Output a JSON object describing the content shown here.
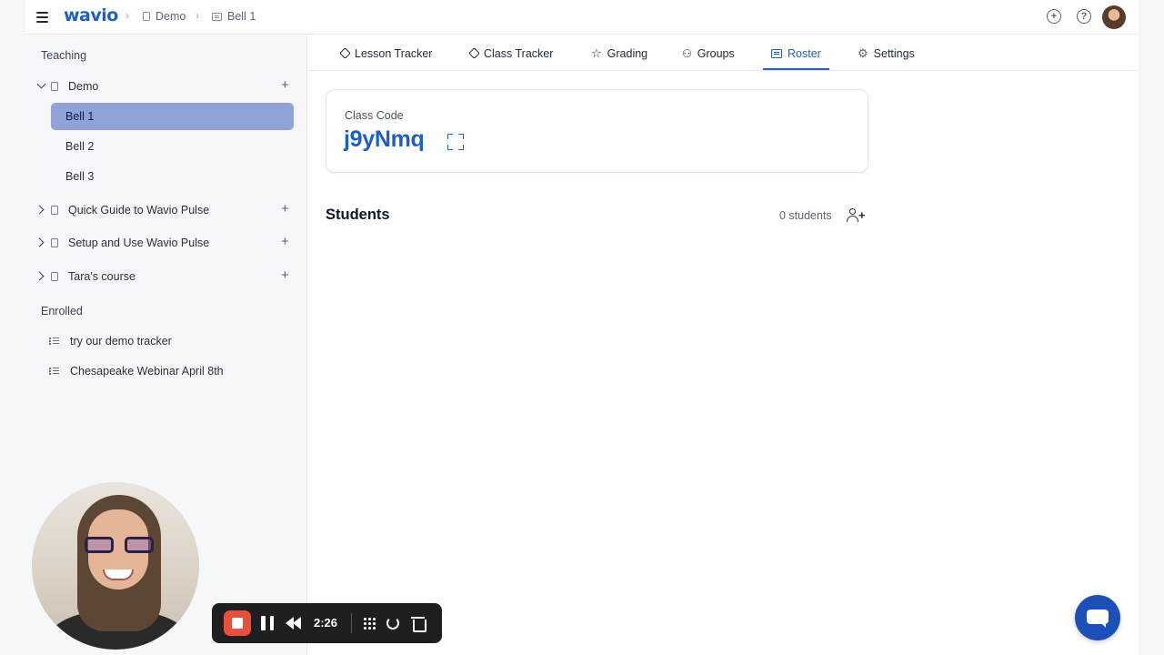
{
  "topbar": {
    "logo": "wavio",
    "breadcrumb": [
      {
        "label": "Demo",
        "icon": "book-icon"
      },
      {
        "label": "Bell 1",
        "icon": "roster-icon"
      }
    ],
    "icons": [
      "add-circle-icon",
      "help-icon",
      "avatar"
    ]
  },
  "sidebar": {
    "teaching_label": "Teaching",
    "courses": [
      {
        "label": "Demo",
        "expanded": true,
        "children": [
          "Bell 1",
          "Bell 2",
          "Bell 3"
        ],
        "active_child": "Bell 1"
      },
      {
        "label": "Quick Guide to Wavio Pulse",
        "expanded": false
      },
      {
        "label": "Setup and Use Wavio Pulse",
        "expanded": false
      },
      {
        "label": "Tara's course",
        "expanded": false
      }
    ],
    "enrolled_label": "Enrolled",
    "enrolled": [
      "try our demo tracker",
      "Chesapeake Webinar April 8th"
    ]
  },
  "tabs": [
    {
      "label": "Lesson Tracker",
      "icon": "diamond-icon"
    },
    {
      "label": "Class Tracker",
      "icon": "diamond-icon"
    },
    {
      "label": "Grading",
      "icon": "star-icon"
    },
    {
      "label": "Groups",
      "icon": "people-icon"
    },
    {
      "label": "Roster",
      "icon": "roster-icon",
      "active": true
    },
    {
      "label": "Settings",
      "icon": "gear-icon"
    }
  ],
  "class_code": {
    "label": "Class Code",
    "code": "j9yNmq"
  },
  "students": {
    "title": "Students",
    "count_text": "0 students"
  },
  "recorder": {
    "time": "2:26"
  },
  "colors": {
    "accent": "#1d5fc4",
    "active_item_bg": "#8fa3d9",
    "record_red": "#e8503c",
    "chat_fab": "#1d4fb8"
  }
}
